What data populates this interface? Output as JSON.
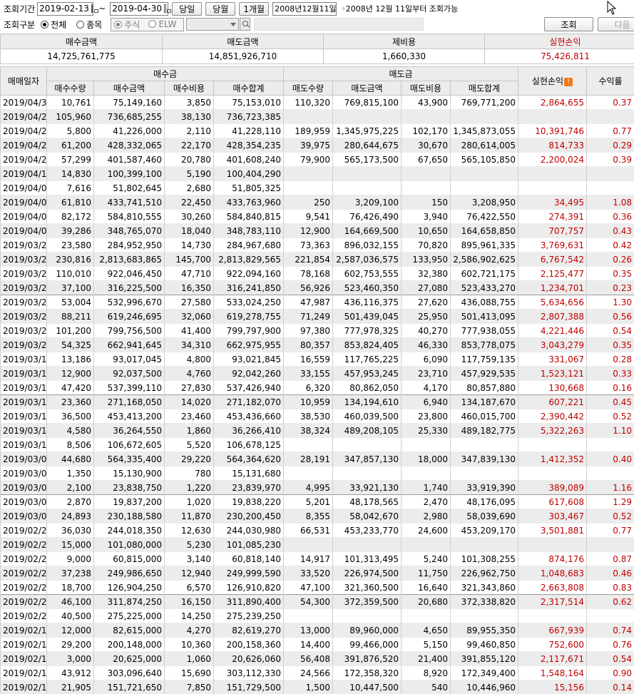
{
  "query": {
    "period_label": "조회기간",
    "start_date": "2019-02-13",
    "tilde": "~",
    "end_date": "2019-04-30",
    "btn_today": "당일",
    "btn_month": "당월",
    "btn_1month": "1개월",
    "since_date": "2008년12월11일",
    "since_note": "◦2008년 12월 11일부터 조회가능",
    "type_label": "조회구분",
    "radio_all": "전체",
    "radio_item": "종목",
    "radio_stock": "주식",
    "radio_elw": "ELW",
    "btn_search": "조회",
    "btn_next": "다음"
  },
  "summary": {
    "headers": [
      "매수금액",
      "매도금액",
      "제비용",
      "실현손익"
    ],
    "values": [
      "14,725,761,775",
      "14,851,926,710",
      "1,660,330",
      "75,426,811"
    ],
    "profit_color": "#c00000"
  },
  "grid": {
    "group_headers": {
      "date": "매매일자",
      "buy": "매수금",
      "sell": "매도금",
      "profit": "실현손익",
      "profit_badge": "!",
      "rate": "수익률"
    },
    "sub_headers": [
      "매수수량",
      "매수금액",
      "매수비용",
      "매수합계",
      "매도수량",
      "매도금액",
      "매도비용",
      "매도합계"
    ],
    "rows": [
      [
        "2019/04/30",
        "10,761",
        "75,149,160",
        "3,850",
        "75,153,010",
        "110,320",
        "769,815,100",
        "43,900",
        "769,771,200",
        "2,864,655",
        "0.37"
      ],
      [
        "2019/04/29",
        "105,960",
        "736,685,255",
        "38,130",
        "736,723,385",
        "",
        "",
        "",
        "",
        "",
        ""
      ],
      [
        "2019/04/26",
        "5,800",
        "41,226,000",
        "2,110",
        "41,228,110",
        "189,959",
        "1,345,975,225",
        "102,170",
        "1,345,873,055",
        "10,391,746",
        "0.77"
      ],
      [
        "2019/04/25",
        "61,200",
        "428,332,065",
        "22,170",
        "428,354,235",
        "39,975",
        "280,644,675",
        "30,670",
        "280,614,005",
        "814,733",
        "0.29"
      ],
      [
        "2019/04/24",
        "57,299",
        "401,587,460",
        "20,780",
        "401,608,240",
        "79,900",
        "565,173,500",
        "67,650",
        "565,105,850",
        "2,200,024",
        "0.39"
      ],
      [
        "2019/04/17",
        "14,830",
        "100,399,100",
        "5,190",
        "100,404,290",
        "",
        "",
        "",
        "",
        "",
        ""
      ],
      [
        "2019/04/05",
        "7,616",
        "51,802,645",
        "2,680",
        "51,805,325",
        "",
        "",
        "",
        "",
        "",
        ""
      ],
      [
        "2019/04/03",
        "61,810",
        "433,741,510",
        "22,450",
        "433,763,960",
        "250",
        "3,209,100",
        "150",
        "3,208,950",
        "34,495",
        "1.08"
      ],
      [
        "2019/04/02",
        "82,172",
        "584,810,555",
        "30,260",
        "584,840,815",
        "9,541",
        "76,426,490",
        "3,940",
        "76,422,550",
        "274,391",
        "0.36"
      ],
      [
        "2019/04/01",
        "39,286",
        "348,765,070",
        "18,040",
        "348,783,110",
        "12,900",
        "164,669,500",
        "10,650",
        "164,658,850",
        "707,757",
        "0.43"
      ],
      [
        "2019/03/29",
        "23,580",
        "284,952,950",
        "14,730",
        "284,967,680",
        "73,363",
        "896,032,155",
        "70,820",
        "895,961,335",
        "3,769,631",
        "0.42"
      ],
      [
        "2019/03/28",
        "230,816",
        "2,813,683,865",
        "145,700",
        "2,813,829,565",
        "221,854",
        "2,587,036,575",
        "133,950",
        "2,586,902,625",
        "6,767,542",
        "0.26"
      ],
      [
        "2019/03/27",
        "110,010",
        "922,046,450",
        "47,710",
        "922,094,160",
        "78,168",
        "602,753,555",
        "32,380",
        "602,721,175",
        "2,125,477",
        "0.35"
      ],
      [
        "2019/03/26",
        "37,100",
        "316,225,500",
        "16,350",
        "316,241,850",
        "56,926",
        "523,460,350",
        "27,080",
        "523,433,270",
        "1,234,701",
        "0.23"
      ],
      [
        "2019/03/25",
        "53,004",
        "532,996,670",
        "27,580",
        "533,024,250",
        "47,987",
        "436,116,375",
        "27,620",
        "436,088,755",
        "5,634,656",
        "1.30"
      ],
      [
        "2019/03/22",
        "88,211",
        "619,246,695",
        "32,060",
        "619,278,755",
        "71,249",
        "501,439,045",
        "25,950",
        "501,413,095",
        "2,807,388",
        "0.56"
      ],
      [
        "2019/03/21",
        "101,200",
        "799,756,500",
        "41,400",
        "799,797,900",
        "97,380",
        "777,978,325",
        "40,270",
        "777,938,055",
        "4,221,446",
        "0.54"
      ],
      [
        "2019/03/20",
        "54,325",
        "662,941,645",
        "34,310",
        "662,975,955",
        "80,357",
        "853,824,405",
        "46,330",
        "853,778,075",
        "3,043,279",
        "0.35"
      ],
      [
        "2019/03/19",
        "13,186",
        "93,017,045",
        "4,800",
        "93,021,845",
        "16,559",
        "117,765,225",
        "6,090",
        "117,759,135",
        "331,067",
        "0.28"
      ],
      [
        "2019/03/18",
        "12,900",
        "92,037,500",
        "4,760",
        "92,042,260",
        "33,155",
        "457,953,245",
        "23,710",
        "457,929,535",
        "1,523,121",
        "0.33"
      ],
      [
        "2019/03/15",
        "47,420",
        "537,399,110",
        "27,830",
        "537,426,940",
        "6,320",
        "80,862,050",
        "4,170",
        "80,857,880",
        "130,668",
        "0.16"
      ],
      [
        "2019/03/14",
        "23,360",
        "271,168,050",
        "14,020",
        "271,182,070",
        "10,959",
        "134,194,610",
        "6,940",
        "134,187,670",
        "607,221",
        "0.45"
      ],
      [
        "2019/03/13",
        "36,500",
        "453,413,200",
        "23,460",
        "453,436,660",
        "38,530",
        "460,039,500",
        "23,800",
        "460,015,700",
        "2,390,442",
        "0.52"
      ],
      [
        "2019/03/12",
        "4,580",
        "36,264,550",
        "1,860",
        "36,266,410",
        "38,324",
        "489,208,105",
        "25,330",
        "489,182,775",
        "5,322,263",
        "1.10"
      ],
      [
        "2019/03/11",
        "8,506",
        "106,672,605",
        "5,520",
        "106,678,125",
        "",
        "",
        "",
        "",
        "",
        ""
      ],
      [
        "2019/03/08",
        "44,680",
        "564,335,400",
        "29,220",
        "564,364,620",
        "28,191",
        "347,857,130",
        "18,000",
        "347,839,130",
        "1,412,352",
        "0.40"
      ],
      [
        "2019/03/07",
        "1,350",
        "15,130,900",
        "780",
        "15,131,680",
        "",
        "",
        "",
        "",
        "",
        ""
      ],
      [
        "2019/03/06",
        "2,100",
        "23,838,750",
        "1,220",
        "23,839,970",
        "4,995",
        "33,921,130",
        "1,740",
        "33,919,390",
        "389,089",
        "1.16"
      ],
      [
        "2019/03/05",
        "2,870",
        "19,837,200",
        "1,020",
        "19,838,220",
        "5,201",
        "48,178,565",
        "2,470",
        "48,176,095",
        "617,608",
        "1.29"
      ],
      [
        "2019/03/04",
        "24,893",
        "230,188,580",
        "11,870",
        "230,200,450",
        "8,355",
        "58,042,670",
        "2,980",
        "58,039,690",
        "303,467",
        "0.52"
      ],
      [
        "2019/02/28",
        "36,030",
        "244,018,350",
        "12,630",
        "244,030,980",
        "66,531",
        "453,233,770",
        "24,600",
        "453,209,170",
        "3,501,881",
        "0.77"
      ],
      [
        "2019/02/27",
        "15,000",
        "101,080,000",
        "5,230",
        "101,085,230",
        "",
        "",
        "",
        "",
        "",
        ""
      ],
      [
        "2019/02/26",
        "9,000",
        "60,815,000",
        "3,140",
        "60,818,140",
        "14,917",
        "101,313,495",
        "5,240",
        "101,308,255",
        "874,176",
        "0.87"
      ],
      [
        "2019/02/25",
        "37,238",
        "249,986,650",
        "12,940",
        "249,999,590",
        "33,520",
        "226,974,500",
        "11,750",
        "226,962,750",
        "1,048,683",
        "0.46"
      ],
      [
        "2019/02/22",
        "18,700",
        "126,904,250",
        "6,570",
        "126,910,820",
        "47,100",
        "321,360,500",
        "16,640",
        "321,343,860",
        "2,663,808",
        "0.83"
      ],
      [
        "2019/02/21",
        "46,100",
        "311,874,250",
        "16,150",
        "311,890,400",
        "54,300",
        "372,359,500",
        "20,680",
        "372,338,820",
        "2,317,514",
        "0.62"
      ],
      [
        "2019/02/20",
        "40,500",
        "275,225,000",
        "14,250",
        "275,239,250",
        "",
        "",
        "",
        "",
        "",
        ""
      ],
      [
        "2019/02/19",
        "12,000",
        "82,615,000",
        "4,270",
        "82,619,270",
        "13,000",
        "89,960,000",
        "4,650",
        "89,955,350",
        "667,939",
        "0.74"
      ],
      [
        "2019/02/18",
        "29,200",
        "200,148,000",
        "10,360",
        "200,158,360",
        "14,400",
        "99,466,000",
        "5,150",
        "99,460,850",
        "752,600",
        "0.76"
      ],
      [
        "2019/02/15",
        "3,000",
        "20,625,000",
        "1,060",
        "20,626,060",
        "56,408",
        "391,876,520",
        "21,400",
        "391,855,120",
        "2,117,671",
        "0.54"
      ],
      [
        "2019/02/14",
        "43,912",
        "303,096,640",
        "15,690",
        "303,112,330",
        "24,566",
        "172,358,320",
        "8,920",
        "172,349,400",
        "1,548,164",
        "0.90"
      ],
      [
        "2019/02/13",
        "21,905",
        "151,721,650",
        "7,850",
        "151,729,500",
        "1,500",
        "10,447,500",
        "540",
        "10,446,960",
        "15,156",
        "0.14"
      ]
    ],
    "week_start_rows": [
      14,
      21,
      28,
      35
    ],
    "profit_color": "#c00000",
    "alt_row_color": "#ececec"
  }
}
